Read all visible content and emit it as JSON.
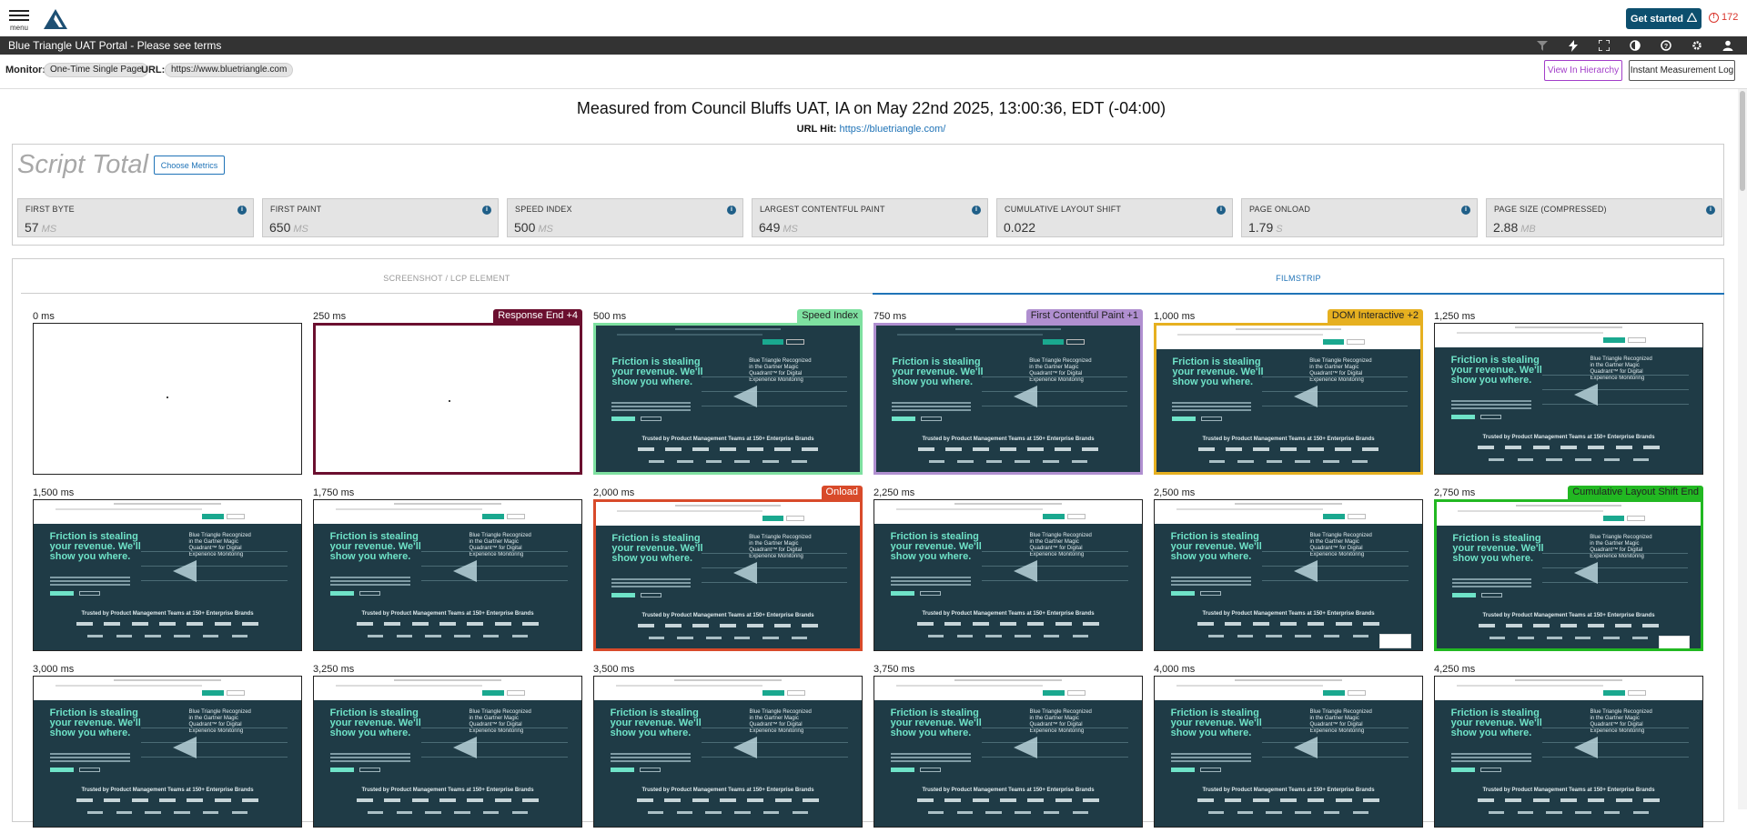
{
  "header": {
    "menu_label": "menu",
    "get_started": "Get started",
    "alert_count": "172"
  },
  "titlebar": {
    "title": "Blue Triangle UAT Portal - Please see terms"
  },
  "toolbar_icons": [
    "filter-icon",
    "bolt-icon",
    "fullscreen-icon",
    "contrast-icon",
    "help-icon",
    "gear-icon",
    "user-icon"
  ],
  "monitor": {
    "monitor_label": "Monitor:",
    "monitor_value": "One-Time Single Page",
    "url_label": "URL:",
    "url_value": "https://www.bluetriangle.com",
    "view_hierarchy": "View In Hierarchy",
    "instant_log": "Instant Measurement Log"
  },
  "measurement": {
    "title": "Measured from Council Bluffs UAT, IA on May 22nd 2025, 13:00:36, EDT (-04:00)",
    "url_hit_label": "URL Hit:",
    "url_hit": "https://bluetriangle.com/"
  },
  "script": {
    "title": "Script Total",
    "choose_metrics": "Choose Metrics",
    "metrics": [
      {
        "label": "FIRST BYTE",
        "value": "57",
        "unit": "MS"
      },
      {
        "label": "FIRST PAINT",
        "value": "650",
        "unit": "MS"
      },
      {
        "label": "SPEED INDEX",
        "value": "500",
        "unit": "MS"
      },
      {
        "label": "LARGEST CONTENTFUL PAINT",
        "value": "649",
        "unit": "MS"
      },
      {
        "label": "CUMULATIVE LAYOUT SHIFT",
        "value": "0.022",
        "unit": ""
      },
      {
        "label": "PAGE ONLOAD",
        "value": "1.79",
        "unit": "S"
      },
      {
        "label": "PAGE SIZE (COMPRESSED)",
        "value": "2.88",
        "unit": "MB"
      }
    ]
  },
  "tabs": [
    {
      "label": "SCREENSHOT / LCP ELEMENT",
      "active": false
    },
    {
      "label": "FILMSTRIP",
      "active": true
    }
  ],
  "hero": {
    "headline": "Friction is stealing your revenue. We'll show you where.",
    "side": "Blue Triangle Recognized in the Gartner Magic Quadrant™ for Digital Experience Monitoring",
    "trusted": "Trusted by Product Management Teams at 150+ Enterprise Brands"
  },
  "frames": [
    {
      "time": "0 ms",
      "badge": "",
      "color": "#222222",
      "state": "blank"
    },
    {
      "time": "250 ms",
      "badge": "Response End +4",
      "color": "#6b0f2f",
      "state": "blank"
    },
    {
      "time": "500 ms",
      "badge": "Speed Index",
      "color": "#7ee0a0",
      "state": "dark"
    },
    {
      "time": "750 ms",
      "badge": "First Contentful Paint +1",
      "color": "#b08fd0",
      "state": "dark"
    },
    {
      "time": "1,000 ms",
      "badge": "DOM Interactive +2",
      "color": "#e6b020",
      "state": "light"
    },
    {
      "time": "1,250 ms",
      "badge": "",
      "color": "#222222",
      "state": "light"
    },
    {
      "time": "1,500 ms",
      "badge": "",
      "color": "#222222",
      "state": "light"
    },
    {
      "time": "1,750 ms",
      "badge": "",
      "color": "#222222",
      "state": "light"
    },
    {
      "time": "2,000 ms",
      "badge": "Onload",
      "color": "#d84a2a",
      "state": "light"
    },
    {
      "time": "2,250 ms",
      "badge": "",
      "color": "#222222",
      "state": "light"
    },
    {
      "time": "2,500 ms",
      "badge": "",
      "color": "#222222",
      "state": "popup"
    },
    {
      "time": "2,750 ms",
      "badge": "Cumulative Layout Shift End",
      "color": "#22b822",
      "state": "popup"
    },
    {
      "time": "3,000 ms",
      "badge": "",
      "color": "#222222",
      "state": "light"
    },
    {
      "time": "3,250 ms",
      "badge": "",
      "color": "#222222",
      "state": "light"
    },
    {
      "time": "3,500 ms",
      "badge": "",
      "color": "#222222",
      "state": "light"
    },
    {
      "time": "3,750 ms",
      "badge": "",
      "color": "#222222",
      "state": "light"
    },
    {
      "time": "4,000 ms",
      "badge": "",
      "color": "#222222",
      "state": "light"
    },
    {
      "time": "4,250 ms",
      "badge": "",
      "color": "#222222",
      "state": "light"
    }
  ]
}
